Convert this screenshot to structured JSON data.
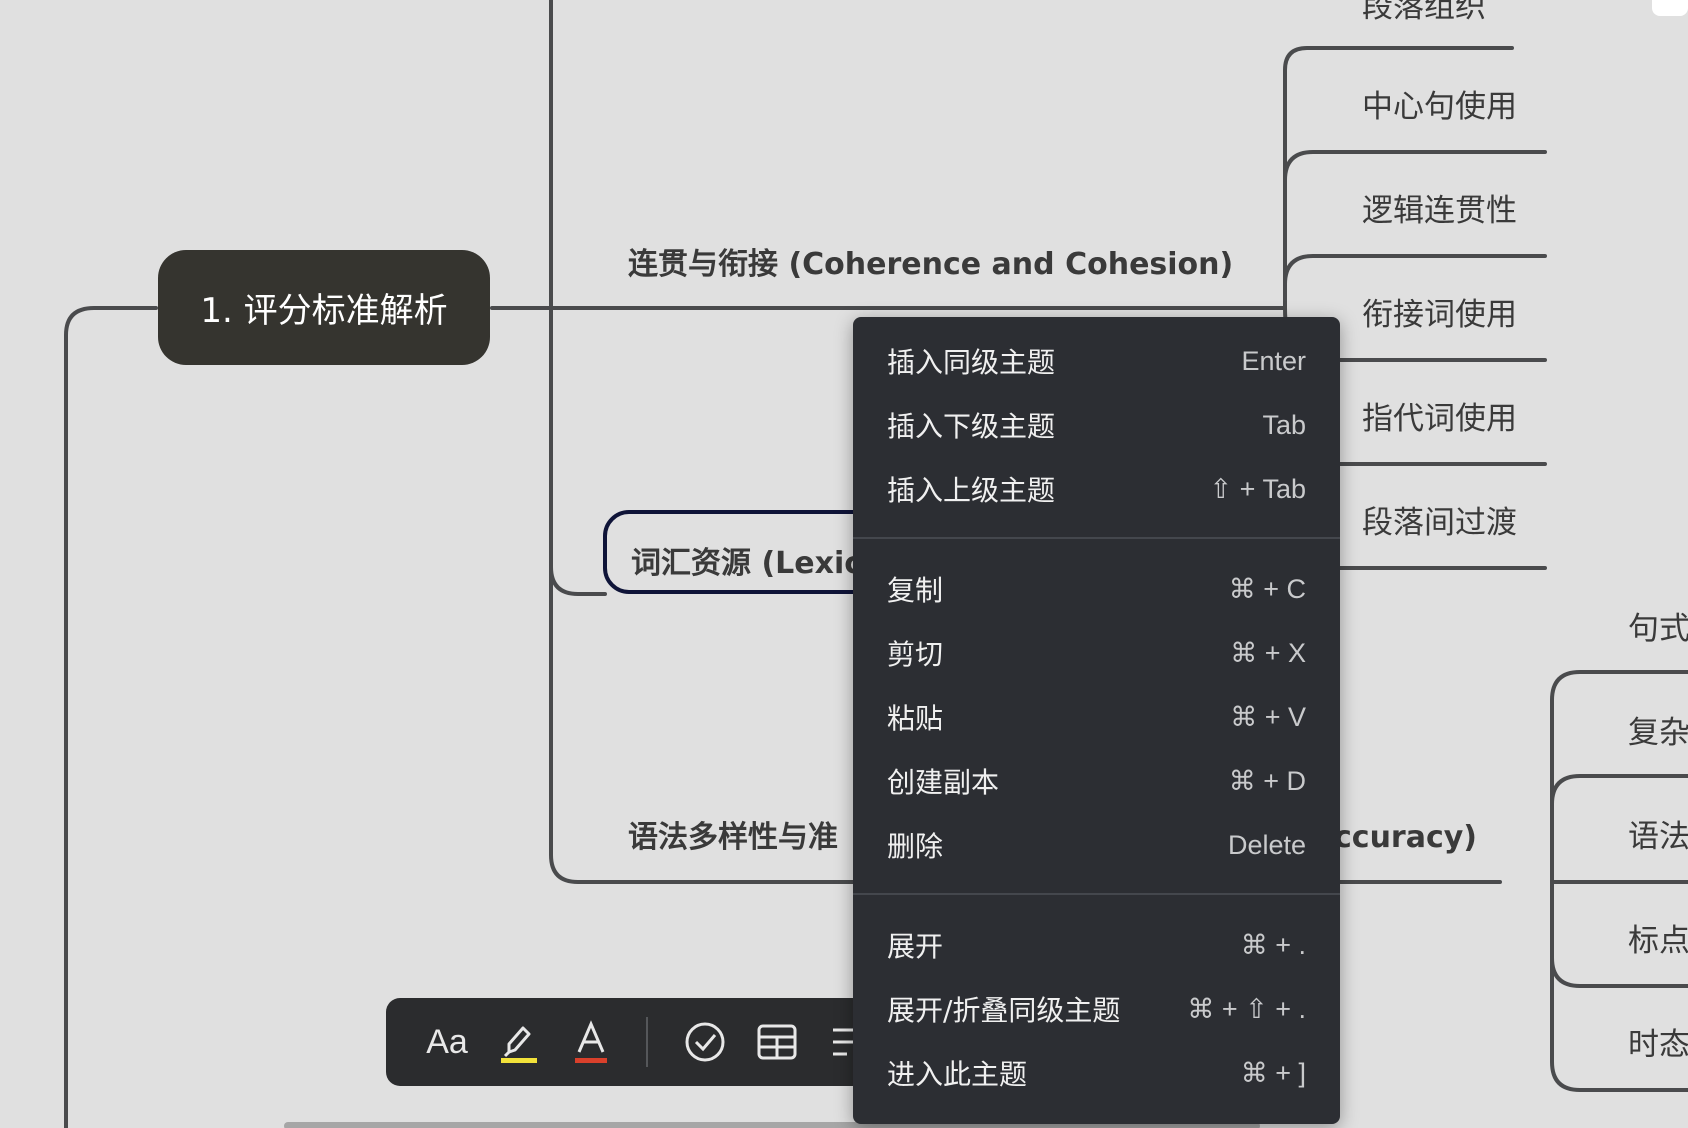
{
  "mindmap": {
    "root": {
      "label": "1. 评分标准解析"
    },
    "branches": {
      "coherence": {
        "label": "连贯与衔接 (Coherence and Cohesion)"
      },
      "lexical": {
        "label": "词汇资源 (Lexic"
      },
      "grammar_left": {
        "label": "语法多样性与准"
      },
      "grammar_right": {
        "label": "ccuracy)"
      }
    },
    "coherence_children": [
      {
        "label": "段落组织"
      },
      {
        "label": "中心句使用"
      },
      {
        "label": "逻辑连贯性"
      },
      {
        "label": "衔接词使用"
      },
      {
        "label": "指代词使用"
      },
      {
        "label": "段落间过渡"
      }
    ],
    "grammar_children": [
      {
        "label": "句式"
      },
      {
        "label": "复杂"
      },
      {
        "label": "语法"
      },
      {
        "label": "标点"
      },
      {
        "label": "时态"
      }
    ]
  },
  "toolbar": {
    "font_label": "Aa",
    "highlight_color": "#f2e23a",
    "text_color": "#d9402b",
    "items": [
      "font-style",
      "highlight",
      "text-color",
      "task",
      "table",
      "list"
    ]
  },
  "context_menu": {
    "groups": [
      [
        {
          "label": "插入同级主题",
          "shortcut": "Enter"
        },
        {
          "label": "插入下级主题",
          "shortcut": "Tab"
        },
        {
          "label": "插入上级主题",
          "shortcut": "⇧ + Tab"
        }
      ],
      [
        {
          "label": "复制",
          "shortcut": "⌘ + C"
        },
        {
          "label": "剪切",
          "shortcut": "⌘ + X"
        },
        {
          "label": "粘贴",
          "shortcut": "⌘ + V"
        },
        {
          "label": "创建副本",
          "shortcut": "⌘ + D"
        },
        {
          "label": "删除",
          "shortcut": "Delete"
        }
      ],
      [
        {
          "label": "展开",
          "shortcut": "⌘ + ."
        },
        {
          "label": "展开/折叠同级主题",
          "shortcut": "⌘ + ⇧ + ."
        },
        {
          "label": "进入此主题",
          "shortcut": "⌘ + ]"
        }
      ]
    ]
  },
  "colors": {
    "canvas": "#e0e0e0",
    "connector": "#4a4b4d",
    "root_fill": "#35342f",
    "selected_border": "#0f1438",
    "menu_bg": "#2c2e33"
  }
}
